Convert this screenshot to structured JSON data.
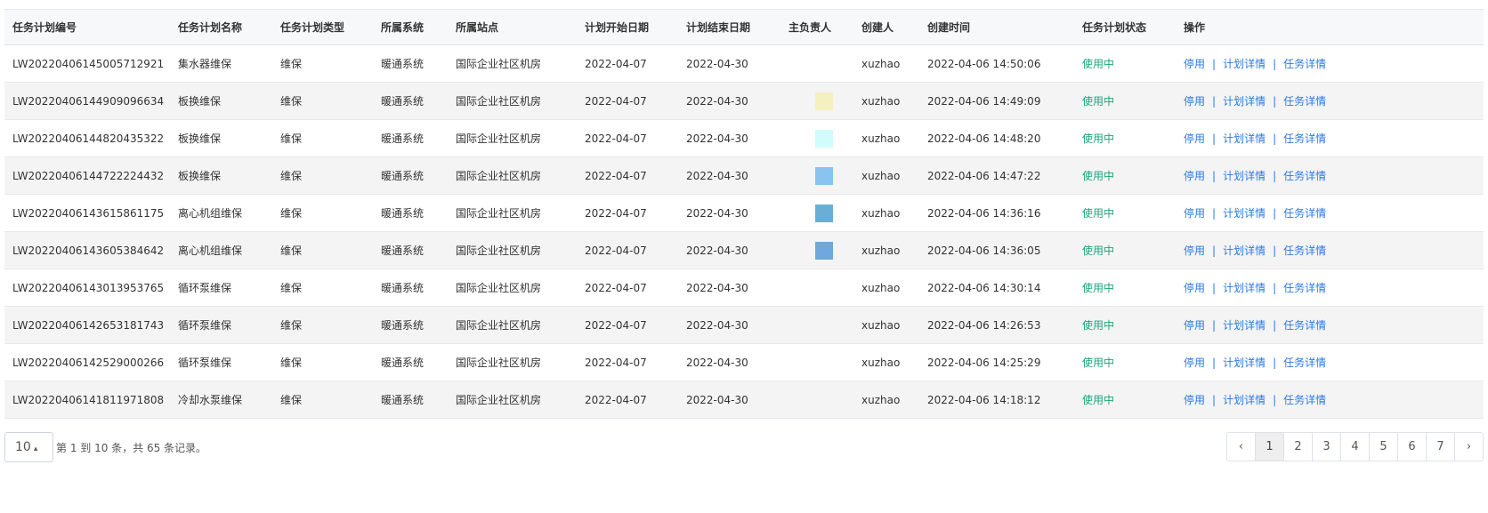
{
  "table": {
    "columns": [
      "任务计划编号",
      "任务计划名称",
      "任务计划类型",
      "所属系统",
      "所属站点",
      "计划开始日期",
      "计划结束日期",
      "主负责人",
      "创建人",
      "创建时间",
      "任务计划状态",
      "操作"
    ],
    "rows": [
      {
        "id": "LW20220406145005712921",
        "name": "集水器维保",
        "type": "维保",
        "system": "暖通系统",
        "site": "国际企业社区机房",
        "start": "2022-04-07",
        "end": "2022-04-30",
        "creator": "xuzhao",
        "created": "2022-04-06 14:50:06",
        "status": "使用中",
        "swatch": ""
      },
      {
        "id": "LW20220406144909096634",
        "name": "板换维保",
        "type": "维保",
        "system": "暖通系统",
        "site": "国际企业社区机房",
        "start": "2022-04-07",
        "end": "2022-04-30",
        "creator": "xuzhao",
        "created": "2022-04-06 14:49:09",
        "status": "使用中",
        "swatch": "#f5f0c0"
      },
      {
        "id": "LW20220406144820435322",
        "name": "板换维保",
        "type": "维保",
        "system": "暖通系统",
        "site": "国际企业社区机房",
        "start": "2022-04-07",
        "end": "2022-04-30",
        "creator": "xuzhao",
        "created": "2022-04-06 14:48:20",
        "status": "使用中",
        "swatch": "#d2fbfb"
      },
      {
        "id": "LW20220406144722224432",
        "name": "板换维保",
        "type": "维保",
        "system": "暖通系统",
        "site": "国际企业社区机房",
        "start": "2022-04-07",
        "end": "2022-04-30",
        "creator": "xuzhao",
        "created": "2022-04-06 14:47:22",
        "status": "使用中",
        "swatch": "#88c4ef"
      },
      {
        "id": "LW20220406143615861175",
        "name": "离心机组维保",
        "type": "维保",
        "system": "暖通系统",
        "site": "国际企业社区机房",
        "start": "2022-04-07",
        "end": "2022-04-30",
        "creator": "xuzhao",
        "created": "2022-04-06 14:36:16",
        "status": "使用中",
        "swatch": "#6aaed6"
      },
      {
        "id": "LW20220406143605384642",
        "name": "离心机组维保",
        "type": "维保",
        "system": "暖通系统",
        "site": "国际企业社区机房",
        "start": "2022-04-07",
        "end": "2022-04-30",
        "creator": "xuzhao",
        "created": "2022-04-06 14:36:05",
        "status": "使用中",
        "swatch": "#6ea8dc"
      },
      {
        "id": "LW20220406143013953765",
        "name": "循环泵维保",
        "type": "维保",
        "system": "暖通系统",
        "site": "国际企业社区机房",
        "start": "2022-04-07",
        "end": "2022-04-30",
        "creator": "xuzhao",
        "created": "2022-04-06 14:30:14",
        "status": "使用中",
        "swatch": ""
      },
      {
        "id": "LW20220406142653181743",
        "name": "循环泵维保",
        "type": "维保",
        "system": "暖通系统",
        "site": "国际企业社区机房",
        "start": "2022-04-07",
        "end": "2022-04-30",
        "creator": "xuzhao",
        "created": "2022-04-06 14:26:53",
        "status": "使用中",
        "swatch": ""
      },
      {
        "id": "LW20220406142529000266",
        "name": "循环泵维保",
        "type": "维保",
        "system": "暖通系统",
        "site": "国际企业社区机房",
        "start": "2022-04-07",
        "end": "2022-04-30",
        "creator": "xuzhao",
        "created": "2022-04-06 14:25:29",
        "status": "使用中",
        "swatch": ""
      },
      {
        "id": "LW20220406141811971808",
        "name": "冷却水泵维保",
        "type": "维保",
        "system": "暖通系统",
        "site": "国际企业社区机房",
        "start": "2022-04-07",
        "end": "2022-04-30",
        "creator": "xuzhao",
        "created": "2022-04-06 14:18:12",
        "status": "使用中",
        "swatch": ""
      }
    ],
    "actions": {
      "disable": "停用",
      "plan_detail": "计划详情",
      "task_detail": "任务详情",
      "separator": "|"
    }
  },
  "footer": {
    "page_size": "10",
    "page_size_caret": "▴",
    "info": "第 1 到 10 条，共 65 条记录。",
    "pages": [
      "‹",
      "1",
      "2",
      "3",
      "4",
      "5",
      "6",
      "7",
      "›"
    ],
    "active_page": "1"
  },
  "colors": {
    "status": "#1ba67a",
    "link": "#2a7ae2",
    "header_bg": "#f7f8fa",
    "stripe": "#f4f4f4"
  }
}
